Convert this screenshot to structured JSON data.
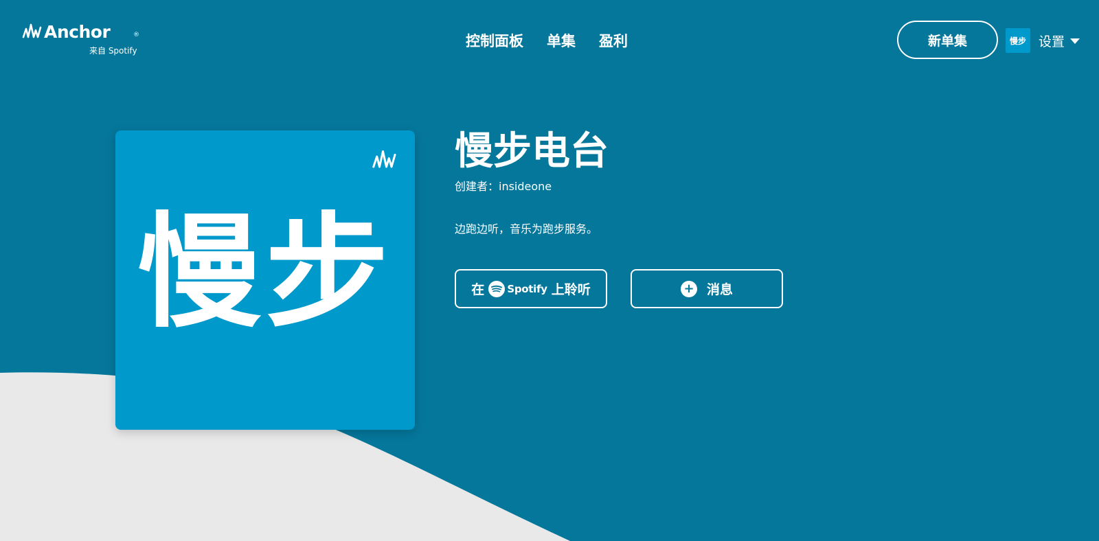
{
  "brand": {
    "name": "Anchor",
    "registered": "®",
    "subtitle": "来自 Spotify"
  },
  "nav": {
    "items": [
      {
        "label": "控制面板"
      },
      {
        "label": "单集"
      },
      {
        "label": "盈利"
      }
    ]
  },
  "header": {
    "new_episode_label": "新单集",
    "avatar_text": "慢步",
    "settings_label": "设置"
  },
  "podcast": {
    "cover_text": "慢步",
    "title": "慢步电台",
    "creator": "创建者：insideone",
    "description": "边跑边听，音乐为跑步服务。"
  },
  "actions": {
    "listen_prefix": "在",
    "spotify_word": "Spotify",
    "listen_suffix": "上聆听",
    "message_label": "消息",
    "message_icon": "plus-chat-icon"
  },
  "colors": {
    "background": "#05779b",
    "cover": "#0099cc",
    "wave": "#e9e9e9"
  },
  "icons": {
    "brand": "anchor-wave-icon",
    "cover_mark": "anchor-wave-icon",
    "settings_caret": "caret-down-icon",
    "spotify": "spotify-icon"
  }
}
